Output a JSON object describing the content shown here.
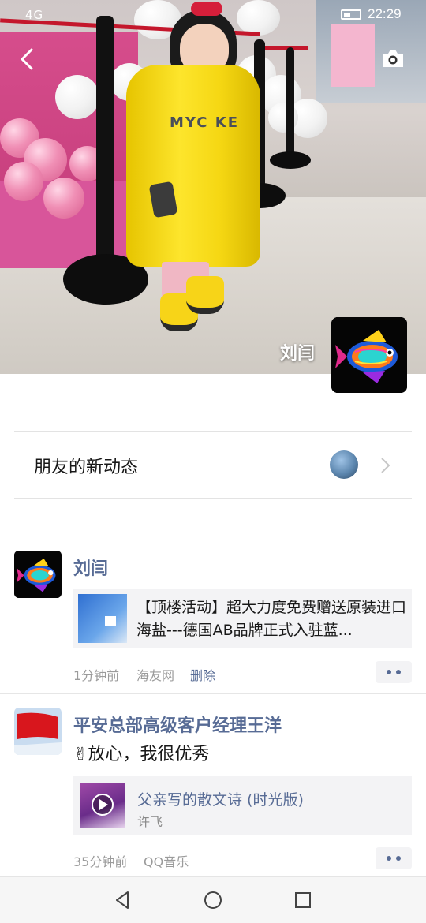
{
  "status_bar": {
    "signal_text": "4G",
    "time": "22:29"
  },
  "header": {
    "back_icon": "back-chevron-icon",
    "camera_icon": "camera-icon"
  },
  "cover": {
    "display_name": "刘闫",
    "coat_text": "MYC KE"
  },
  "friends_updates": {
    "label": "朋友的新动态"
  },
  "feed": [
    {
      "author": "刘闫",
      "link_title": "【顶楼活动】超大力度免费赠送原装进口海盐---德国AB品牌正式入驻蓝...",
      "time": "1分钟前",
      "source": "海友网",
      "delete_label": "删除"
    },
    {
      "author": "平安总部高级客户经理王洋",
      "text": "✌放心，我很优秀",
      "music_title": "父亲写的散文诗 (时光版)",
      "music_artist": "许飞",
      "time": "35分钟前",
      "source": "QQ音乐"
    }
  ],
  "colors": {
    "link_blue": "#576b95",
    "meta_gray": "#9b9b9b",
    "card_bg": "#f3f3f5"
  },
  "navbar": {
    "back_icon": "triangle-back-icon",
    "home_icon": "circle-home-icon",
    "recents_icon": "square-recents-icon"
  }
}
